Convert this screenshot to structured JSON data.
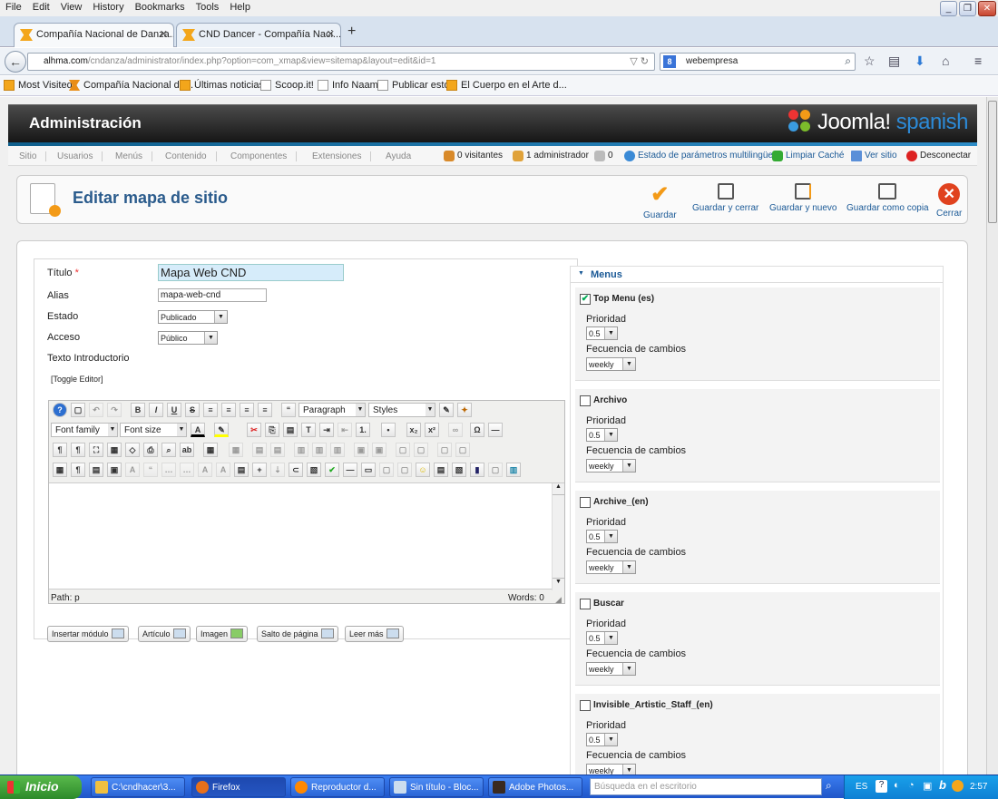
{
  "browser": {
    "menu": [
      "File",
      "Edit",
      "View",
      "History",
      "Bookmarks",
      "Tools",
      "Help"
    ],
    "tabs": [
      {
        "label": "Compañía Nacional de Danza...."
      },
      {
        "label": "CND Dancer - Compañía Naci..."
      }
    ],
    "url_host": "alhma.com",
    "url_path": "/cndanza/administrator/index.php?option=com_xmap&view=sitemap&layout=edit&id=1",
    "search_value": "webempresa",
    "bookmarks": [
      "Most Visited",
      "Compañía Nacional de...",
      "Últimas noticias",
      "Scoop.it!",
      "Info Naam",
      "Publicar esto",
      "El Cuerpo en el Arte d..."
    ]
  },
  "joomla": {
    "header_title": "Administración",
    "logo_text": "Joomla!",
    "logo_sub": "spanish",
    "nav": [
      "Sitio",
      "Usuarios",
      "Menús",
      "Contenido",
      "Componentes",
      "Extensiones",
      "Ayuda"
    ],
    "status": {
      "visitors": "0 visitantes",
      "admins": "1 administrador",
      "messages": "0",
      "multilang": "Estado de parámetros multilingüe",
      "cache": "Limpiar Caché",
      "view_site": "Ver sitio",
      "logout": "Desconectar"
    },
    "page_title": "Editar mapa de sitio",
    "toolbar": {
      "save": "Guardar",
      "save_close": "Guardar y cerrar",
      "save_new": "Guardar y nuevo",
      "save_copy": "Guardar como copia",
      "close": "Cerrar"
    }
  },
  "form": {
    "title_label": "Título",
    "title_required": "*",
    "title_value": "Mapa Web CND",
    "alias_label": "Alias",
    "alias_value": "mapa-web-cnd",
    "state_label": "Estado",
    "state_value": "Publicado",
    "access_label": "Acceso",
    "access_value": "Público",
    "intro_label": "Texto Introductorio",
    "toggle_editor": "[Toggle Editor]",
    "editor": {
      "paragraph": "Paragraph",
      "styles": "Styles",
      "font_family": "Font family",
      "font_size": "Font size",
      "path": "Path:  p",
      "words": "Words: 0"
    },
    "buttons": {
      "insert_module": "Insertar módulo",
      "article": "Artículo",
      "image": "Imagen",
      "page_break": "Salto de página",
      "read_more": "Leer más"
    }
  },
  "menus_panel": {
    "heading": "Menus",
    "priority_label": "Prioridad",
    "frequency_label": "Fecuencia de cambios",
    "items": [
      {
        "name": "Top Menu (es)",
        "checked": true,
        "priority": "0.5",
        "frequency": "weekly"
      },
      {
        "name": "Archivo",
        "checked": false,
        "priority": "0.5",
        "frequency": "weekly"
      },
      {
        "name": "Archive_(en)",
        "checked": false,
        "priority": "0.5",
        "frequency": "weekly"
      },
      {
        "name": "Buscar",
        "checked": false,
        "priority": "0.5",
        "frequency": "weekly"
      },
      {
        "name": "Invisible_Artistic_Staff_(en)",
        "checked": false,
        "priority": "0.5",
        "frequency": "weekly"
      }
    ]
  },
  "taskbar": {
    "start": "Inicio",
    "tasks": [
      "C:\\cndhacer\\3...",
      "Firefox",
      "Reproductor d...",
      "Sin título - Bloc...",
      "Adobe Photos..."
    ],
    "search_placeholder": "Búsqueda en el escritorio",
    "lang": "ES",
    "clock": "2:57"
  },
  "colors": {
    "accent": "#1a5996",
    "header_bg": "#222222",
    "title": "#2a5b8c",
    "required": "#ee3333"
  }
}
